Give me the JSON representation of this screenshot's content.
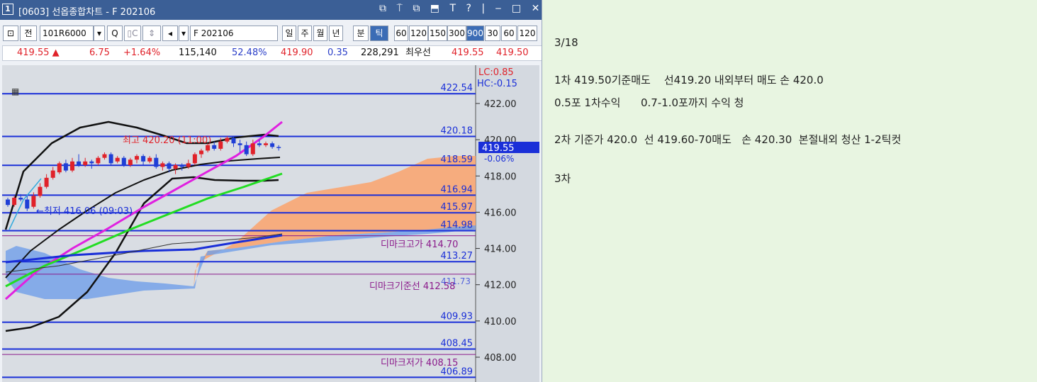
{
  "window": {
    "number": "1",
    "title": "[0603]  선옵종합차트 - F 202106",
    "controls": [
      "⧉",
      "⍑",
      "⧉",
      "⬒",
      "T",
      "?",
      "|",
      "‒",
      "□",
      "✕"
    ]
  },
  "toolbar": {
    "items": [
      "전",
      "101R6000",
      "▾",
      "Q",
      "",
      "",
      "◂",
      "▾",
      "F 202106",
      "일",
      "주",
      "월",
      "년",
      "분",
      "틱",
      "60",
      "120",
      "150",
      "300",
      "900",
      "30",
      "60",
      "120"
    ]
  },
  "quote": {
    "price": "419.55 ▲",
    "change": "6.75",
    "change_pct": "+1.64%",
    "volume": "115,140",
    "vol_pct": "52.48%",
    "v2": "419.90",
    "v3": "0.35",
    "v4": "228,291",
    "label": "최우선",
    "bid": "419.55",
    "ask": "419.50"
  },
  "chart": {
    "lc": "LC:0.85",
    "hc": "HC:-0.15",
    "y_ticks": [
      "422.00",
      "420.00",
      "418.00",
      "416.00",
      "414.00",
      "412.00",
      "410.00",
      "408.00"
    ],
    "levels": [
      "422.54",
      "420.18",
      "418.59",
      "416.94",
      "415.97",
      "414.98",
      "413.27",
      "409.93",
      "408.45",
      "406.89"
    ],
    "demark_high": "디마크고가 414.70",
    "demark_base": "디마크기준선 412.58",
    "demark_low": "디마크저가 408.15",
    "cur_price": "419.55",
    "cur_pct": "-0.06%",
    "high_label": "최고 420.20 (11:00)",
    "low_label": "←최저 416.06 (09:03)",
    "overlap_label": "411.73",
    "colors": {
      "candle_up": "#e0222a",
      "candle_down": "#1f3fd6",
      "level": "#1a2fd8",
      "cloud_orange": "#f8a978",
      "cloud_blue": "#6f9fe8"
    }
  },
  "chart_data": {
    "type": "candlestick",
    "ylim": [
      406.5,
      423.5
    ],
    "candles": [
      [
        416.7,
        416.4,
        416.8,
        416.3
      ],
      [
        416.4,
        416.8,
        416.9,
        416.3
      ],
      [
        416.8,
        416.7,
        417.0,
        416.6
      ],
      [
        416.7,
        416.2,
        416.9,
        416.06
      ],
      [
        416.3,
        416.9,
        417.1,
        416.2
      ],
      [
        416.9,
        417.4,
        417.6,
        416.8
      ],
      [
        417.4,
        417.9,
        418.1,
        417.3
      ],
      [
        417.9,
        418.3,
        418.5,
        417.8
      ],
      [
        418.2,
        418.7,
        418.8,
        418.1
      ],
      [
        418.7,
        418.3,
        418.9,
        418.2
      ],
      [
        418.3,
        418.8,
        419.0,
        418.2
      ],
      [
        418.8,
        418.6,
        419.2,
        418.5
      ],
      [
        418.6,
        418.8,
        419.0,
        418.5
      ],
      [
        418.8,
        418.7,
        418.9,
        418.4
      ],
      [
        418.7,
        419.0,
        419.1,
        418.6
      ],
      [
        419.0,
        419.2,
        419.3,
        418.9
      ],
      [
        419.2,
        418.7,
        419.3,
        418.6
      ],
      [
        418.8,
        419.0,
        419.1,
        418.7
      ],
      [
        419.0,
        418.6,
        419.1,
        418.5
      ],
      [
        418.6,
        418.9,
        419.0,
        418.5
      ],
      [
        418.9,
        419.1,
        419.2,
        418.7
      ],
      [
        419.1,
        418.8,
        419.2,
        418.6
      ],
      [
        418.8,
        419.0,
        419.1,
        418.7
      ],
      [
        419.0,
        418.5,
        419.2,
        418.4
      ],
      [
        418.5,
        418.7,
        418.8,
        418.3
      ],
      [
        418.7,
        418.4,
        418.8,
        418.2
      ],
      [
        418.4,
        418.6,
        418.7,
        418.1
      ],
      [
        418.6,
        418.5,
        418.7,
        418.3
      ],
      [
        418.5,
        418.7,
        418.9,
        418.4
      ],
      [
        418.7,
        419.2,
        419.3,
        418.6
      ],
      [
        419.2,
        419.4,
        419.5,
        419.0
      ],
      [
        419.4,
        419.7,
        419.8,
        419.3
      ],
      [
        419.7,
        419.5,
        419.9,
        419.4
      ],
      [
        419.5,
        419.9,
        420.1,
        419.4
      ],
      [
        419.9,
        420.1,
        420.2,
        419.8
      ],
      [
        420.1,
        419.8,
        420.2,
        419.6
      ],
      [
        419.8,
        419.7,
        420.0,
        419.3
      ],
      [
        419.7,
        419.2,
        419.9,
        419.1
      ],
      [
        419.2,
        419.8,
        420.0,
        419.1
      ],
      [
        419.8,
        419.7,
        420.0,
        419.6
      ],
      [
        419.7,
        419.8,
        419.9,
        419.6
      ],
      [
        419.8,
        419.6,
        419.9,
        419.5
      ],
      [
        419.6,
        419.55,
        419.7,
        419.4
      ]
    ]
  },
  "notes": {
    "date": "3/18",
    "line1": "1차 419.50기준매도    선419.20 내외부터 매도 손 420.0",
    "line2": "0.5포 1차수익      0.7-1.0포까지 수익 청",
    "line3": "2차 기준가 420.0  선 419.60-70매도   손 420.30  본절내외 청산 1-2틱컷",
    "line4": "3차"
  }
}
